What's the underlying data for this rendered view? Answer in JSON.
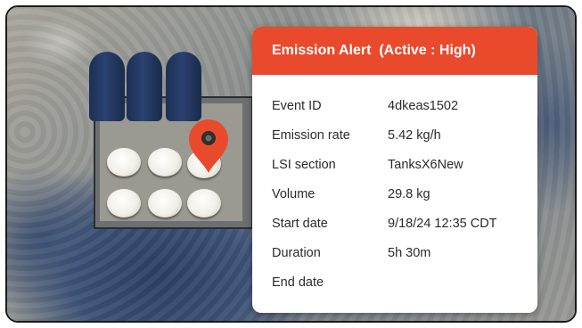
{
  "alert": {
    "title": "Emission Alert",
    "status": "(Active : High)",
    "accent_color": "#e94a2c",
    "fields": [
      {
        "label": "Event ID",
        "value": "4dkeas1502"
      },
      {
        "label": "Emission rate",
        "value": "5.42 kg/h"
      },
      {
        "label": "LSI section",
        "value": "TanksX6New"
      },
      {
        "label": "Volume",
        "value": "29.8 kg"
      },
      {
        "label": "Start date",
        "value": "9/18/24 12:35 CDT"
      },
      {
        "label": "Duration",
        "value": "5h 30m"
      },
      {
        "label": "End date",
        "value": ""
      }
    ]
  },
  "map": {
    "marker_icon": "map-pin-icon",
    "marker_color": "#e94a2c"
  }
}
